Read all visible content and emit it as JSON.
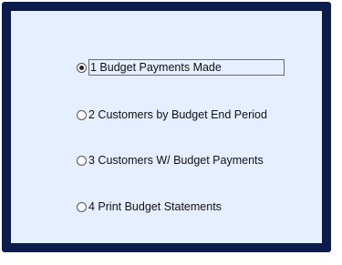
{
  "options": [
    {
      "label": "1 Budget Payments Made",
      "checked": true
    },
    {
      "label": "2 Customers by Budget End Period",
      "checked": false
    },
    {
      "label": "3 Customers W/ Budget Payments",
      "checked": false
    },
    {
      "label": "4 Print Budget Statements",
      "checked": false
    }
  ]
}
